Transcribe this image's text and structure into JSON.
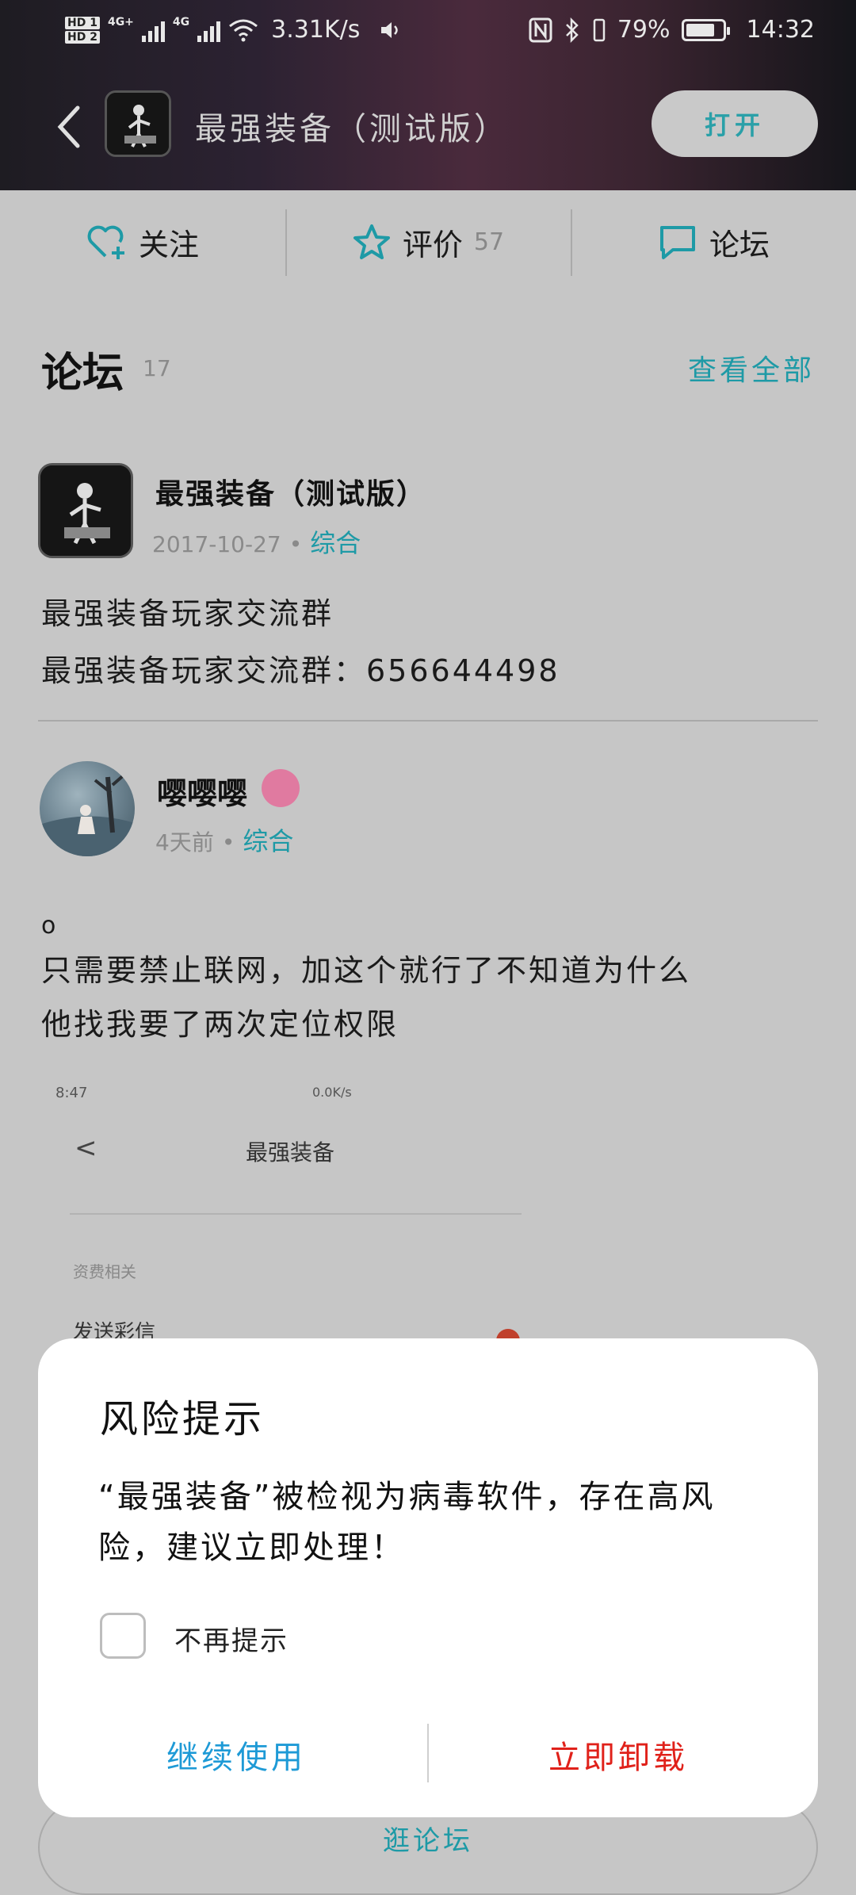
{
  "status_bar": {
    "hd1": "HD 1",
    "hd2": "HD 2",
    "net1": "4G+",
    "net2": "4G",
    "speed": "3.31K/s",
    "battery_text": "79%",
    "battery_level": 0.79,
    "time": "14:32"
  },
  "app_header": {
    "title": "最强装备（测试版）",
    "open_button": "打开"
  },
  "actions": {
    "follow": "关注",
    "rate": "评价",
    "rate_count": "57",
    "forum": "论坛"
  },
  "forum": {
    "title": "论坛",
    "count": "17",
    "view_all": "查看全部"
  },
  "post1": {
    "author": "最强装备（测试版）",
    "date": "2017-10-27",
    "separator": "•",
    "category": "综合",
    "line1": "最强装备玩家交流群",
    "line2": "最强装备玩家交流群：656644498"
  },
  "post2": {
    "author": "嘤嘤嘤",
    "time": "4天前",
    "separator": "•",
    "category": "综合",
    "mark": "o",
    "line1": "只需要禁止联网，加这个就行了不知道为什么",
    "line2": "他找我要了两次定位权限"
  },
  "embedded_screenshot": {
    "time": "8:47",
    "status": "0.0K/s",
    "back": "<",
    "title": "最强装备",
    "section": "资费相关",
    "item": "发送彩信"
  },
  "bottom_button": "逛论坛",
  "dialog": {
    "title": "风险提示",
    "message": "“最强装备”被检视为病毒软件，存在高风险，建议立即处理！",
    "checkbox_label": "不再提示",
    "continue_button": "继续使用",
    "uninstall_button": "立即卸载"
  },
  "colors": {
    "accent_teal": "#1e9aa6",
    "continue_blue": "#1e9ad6",
    "uninstall_red": "#e0211a"
  }
}
